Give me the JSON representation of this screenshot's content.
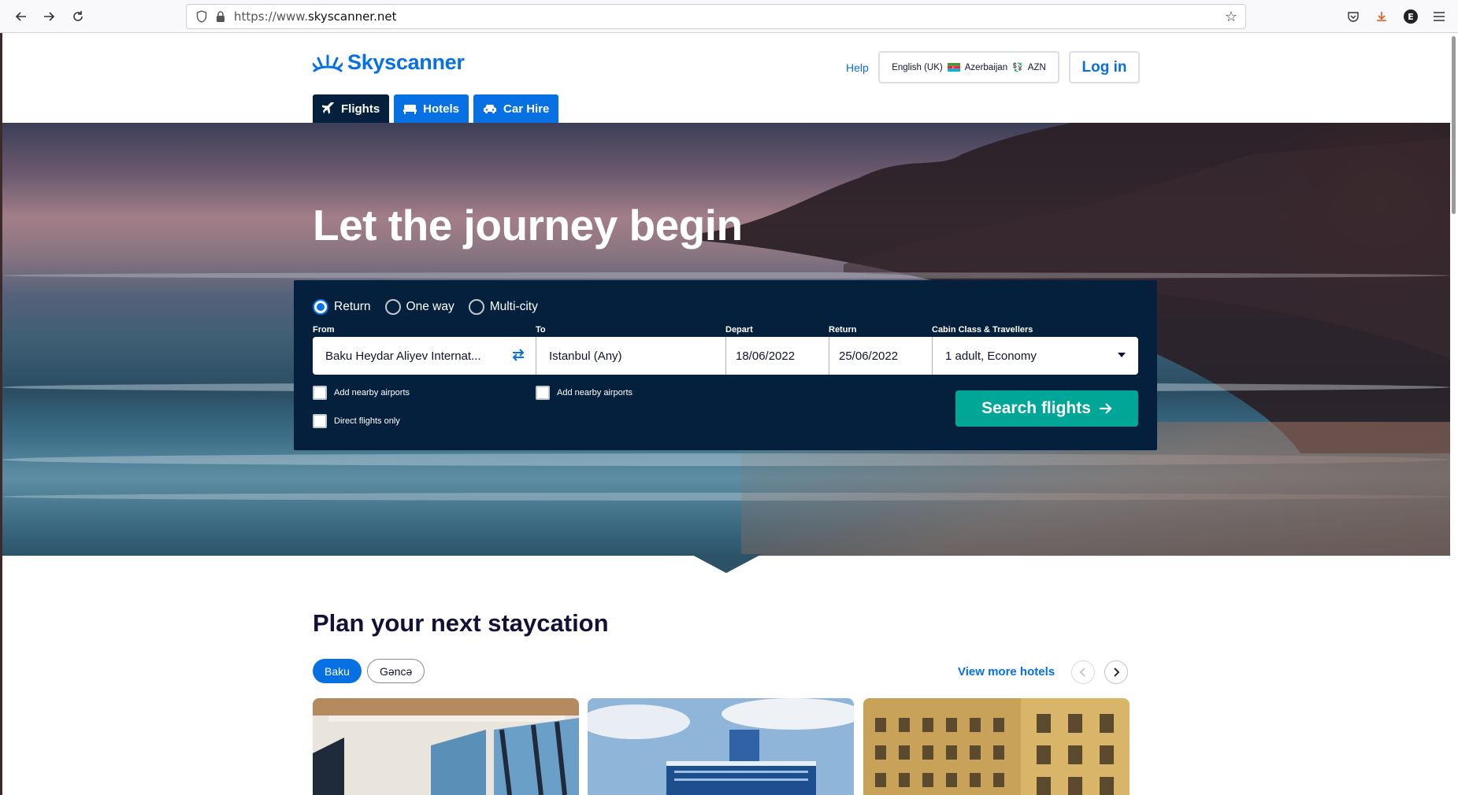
{
  "browser": {
    "url_prefix": "https://www.",
    "url_domain": "skyscanner.net"
  },
  "header": {
    "logo_text": "Skyscanner",
    "help_label": "Help",
    "language": "English (UK)",
    "country": "Azerbaijan",
    "currency": "AZN",
    "login_label": "Log in"
  },
  "tabs": [
    {
      "label": "Flights",
      "icon": "plane-icon",
      "active": true
    },
    {
      "label": "Hotels",
      "icon": "bed-icon",
      "active": false
    },
    {
      "label": "Car Hire",
      "icon": "car-icon",
      "active": false
    }
  ],
  "hero": {
    "title": "Let the journey begin"
  },
  "search": {
    "trip_types": [
      {
        "label": "Return",
        "selected": true
      },
      {
        "label": "One way",
        "selected": false
      },
      {
        "label": "Multi-city",
        "selected": false
      }
    ],
    "from_label": "From",
    "from_value": "Baku Heydar Aliyev Internat...",
    "to_label": "To",
    "to_value": "Istanbul (Any)",
    "depart_label": "Depart",
    "depart_value": "18/06/2022",
    "return_label": "Return",
    "return_value": "25/06/2022",
    "cabin_label": "Cabin Class & Travellers",
    "cabin_value": "1 adult, Economy",
    "nearby_from_label": "Add nearby airports",
    "nearby_to_label": "Add nearby airports",
    "direct_label": "Direct flights only",
    "search_button": "Search flights"
  },
  "staycation": {
    "title": "Plan your next staycation",
    "chips": [
      "Baku",
      "Gəncə"
    ],
    "view_more": "View more hotels"
  },
  "colors": {
    "brand_blue": "#0770e3",
    "navy": "#05203c",
    "teal": "#00a698"
  }
}
